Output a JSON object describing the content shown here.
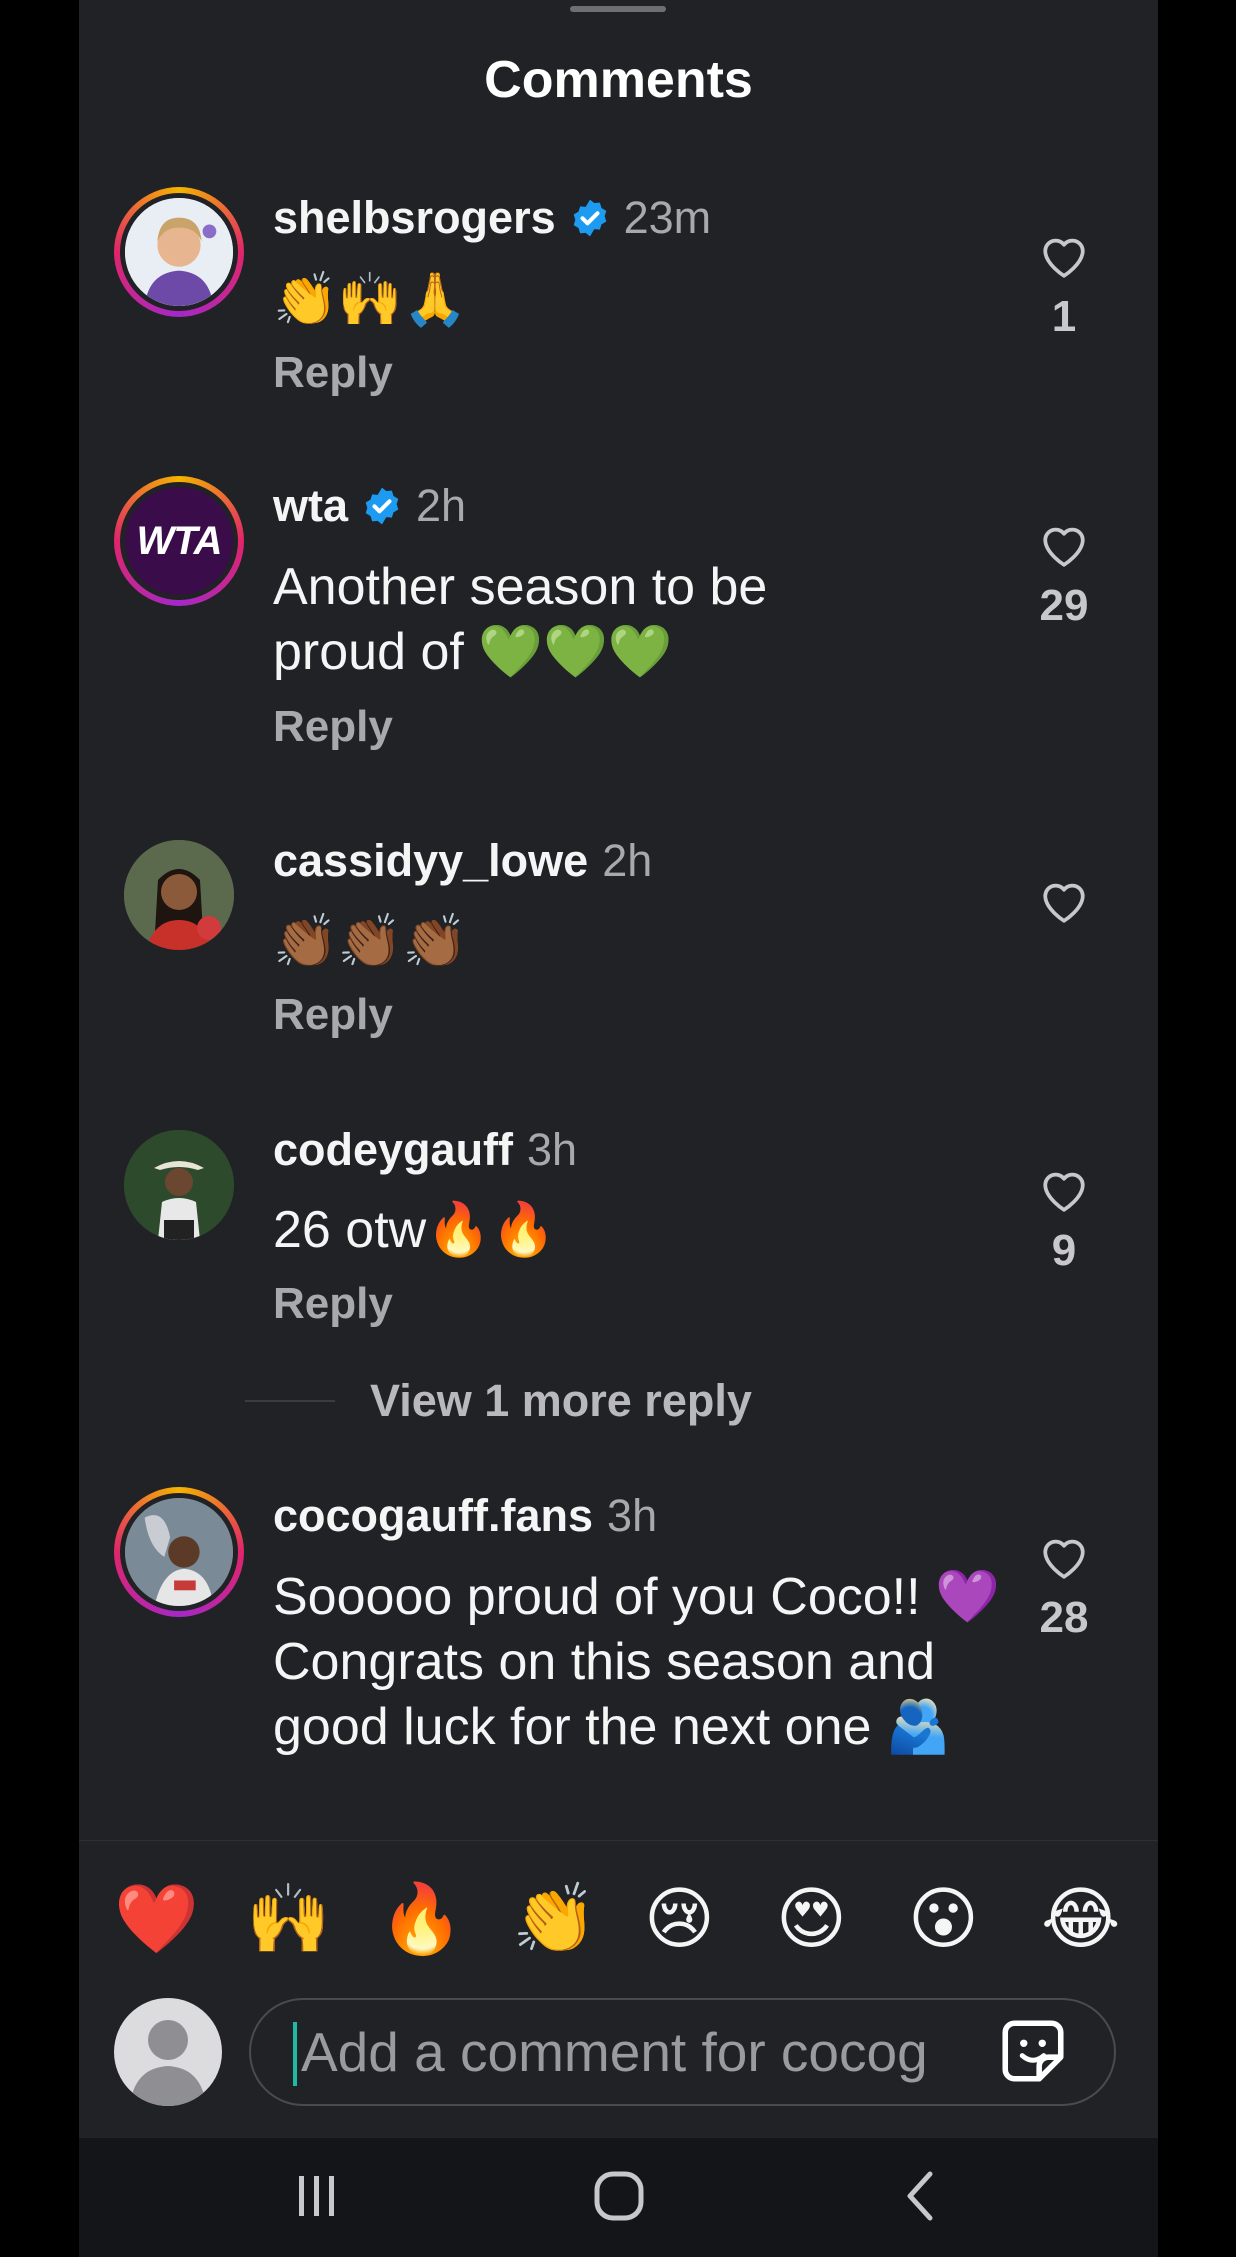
{
  "header": {
    "title": "Comments"
  },
  "comments": [
    {
      "username": "shelbsrogers",
      "verified": true,
      "time": "23m",
      "text": "👏🙌🙏",
      "reply": "Reply",
      "likes": "1",
      "avatar": "photo-woman-icon"
    },
    {
      "username": "wta",
      "verified": true,
      "time": "2h",
      "text": "Another season to be proud of 💚💚💚",
      "reply": "Reply",
      "likes": "29",
      "avatar_text": "WTA"
    },
    {
      "username": "cassidyy_lowe",
      "verified": false,
      "time": "2h",
      "text": "👏🏾👏🏾👏🏾",
      "reply": "Reply",
      "likes": "",
      "avatar": "photo-woman-icon"
    },
    {
      "username": "codeygauff",
      "verified": false,
      "time": "3h",
      "text": "26 otw🔥🔥",
      "reply": "Reply",
      "likes": "9",
      "avatar": "photo-man-icon"
    },
    {
      "username": "cocogauff.fans",
      "verified": false,
      "time": "3h",
      "text": "Sooooo proud of you Coco!! 💜 Congrats on this season and good luck for the next one 🫂",
      "reply": "",
      "likes": "28",
      "avatar": "photo-trophy-icon"
    }
  ],
  "view_more_replies": "View 1 more reply",
  "quick_reactions": [
    "❤️",
    "🙌",
    "🔥",
    "👏",
    "😢",
    "😍",
    "😮",
    "😂"
  ],
  "composer": {
    "placeholder": "Add a comment for cocog"
  },
  "colors": {
    "background": "#212226",
    "accent_ring_start": "#f5b300",
    "accent_ring_end": "#a428c7",
    "verified": "#1d9bf0"
  }
}
